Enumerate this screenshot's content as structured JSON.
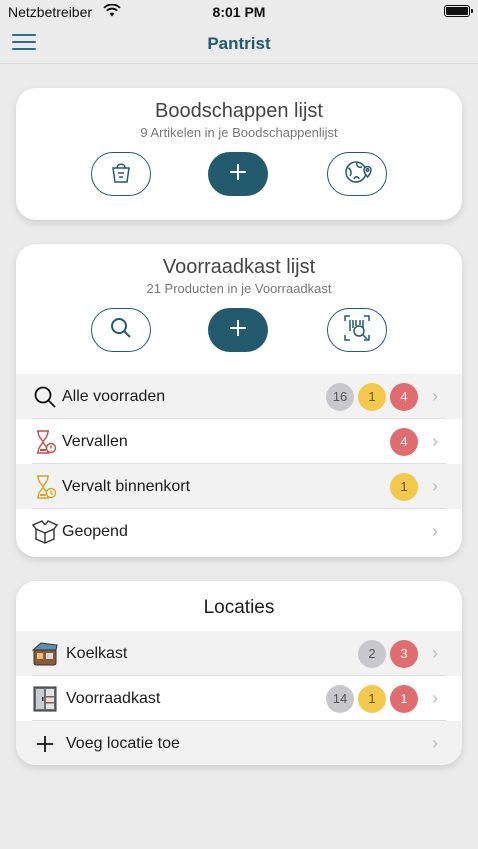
{
  "statusbar": {
    "carrier": "Netzbetreiber",
    "time": "8:01 PM"
  },
  "navbar": {
    "title": "Pantrist"
  },
  "shopping": {
    "title": "Boodschappen lijst",
    "subtitle": "9 Artikelen in je Boodschappenlijst"
  },
  "pantry": {
    "title": "Voorraadkast lijst",
    "subtitle": "21 Producten in je Voorraadkast",
    "rows": [
      {
        "label": "Alle voorraden",
        "badges": [
          "16",
          "1",
          "4"
        ]
      },
      {
        "label": "Vervallen",
        "badges": [
          "4"
        ]
      },
      {
        "label": "Vervalt binnenkort",
        "badges": [
          "1"
        ]
      },
      {
        "label": "Geopend"
      }
    ]
  },
  "locations": {
    "title": "Locaties",
    "rows": [
      {
        "label": "Koelkast",
        "badges": [
          "2",
          "3"
        ]
      },
      {
        "label": "Voorraadkast",
        "badges": [
          "14",
          "1",
          "1"
        ]
      },
      {
        "label": "Voeg locatie toe"
      }
    ]
  },
  "colors": {
    "accent": "#245a6d",
    "grey_badge": "#c8c8cc",
    "yellow_badge": "#f2c94c",
    "red_badge": "#e06c6f"
  }
}
